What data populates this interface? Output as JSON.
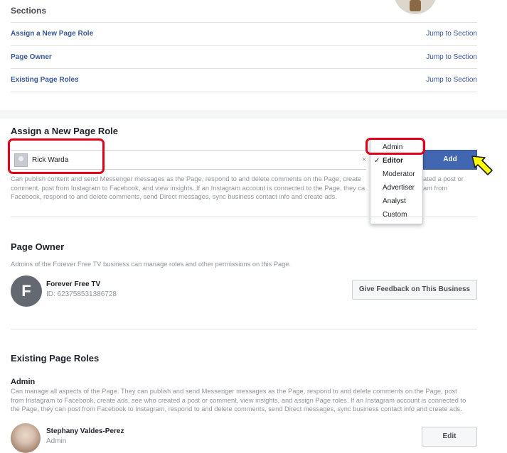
{
  "sections": {
    "title": "Sections",
    "jump_label": "Jump to Section",
    "items": [
      {
        "label": "Assign a New Page Role"
      },
      {
        "label": "Page Owner"
      },
      {
        "label": "Existing Page Roles"
      }
    ]
  },
  "assign": {
    "title": "Assign a New Page Role",
    "user_value": "Rick Warda",
    "clear_icon": "×",
    "add_label": "Add",
    "description_lines": [
      "Can publish content and send Messenger messages as the Page, respond to and delete comments on the Page, create",
      "comment, post from Instagram to Facebook, and view insights. If an Instagram account is connected to the Page, they ca",
      "Facebook, respond to and delete comments, send Direct messages, sync business contact info and create ads."
    ],
    "description_tail": [
      "ated a post or",
      "am from"
    ],
    "dropdown": {
      "selected": "Editor",
      "check": "✓",
      "options": [
        "Admin",
        "Editor",
        "Moderator",
        "Advertiser",
        "Analyst",
        "Custom"
      ]
    }
  },
  "owner": {
    "title": "Page Owner",
    "subtitle": "Admins of the Forever Free TV business can manage roles and other permissions on this Page.",
    "avatar_letter": "F",
    "name": "Forever Free TV",
    "id": "ID: 623758531386728",
    "feedback_button": "Give Feedback on This Business"
  },
  "existing": {
    "title": "Existing Page Roles",
    "role_title": "Admin",
    "role_description_lines": [
      "Can manage all aspects of the Page. They can publish and send Messenger messages as the Page, respond to and delete comments on the Page, post",
      "from Instagram to Facebook, create ads, see who created a post or comment, view insights, and assign Page roles. If an Instagram account is connected to",
      "the Page, they can post from Facebook to Instagram, respond to and delete comments, send Direct messages, sync business contact info and create ads."
    ],
    "person_name": "Stephany Valdes-Perez",
    "person_role": "Admin",
    "edit_label": "Edit"
  },
  "annotation": {
    "highlight_color": "#e3001b",
    "arrow_color": "#ffff00"
  }
}
